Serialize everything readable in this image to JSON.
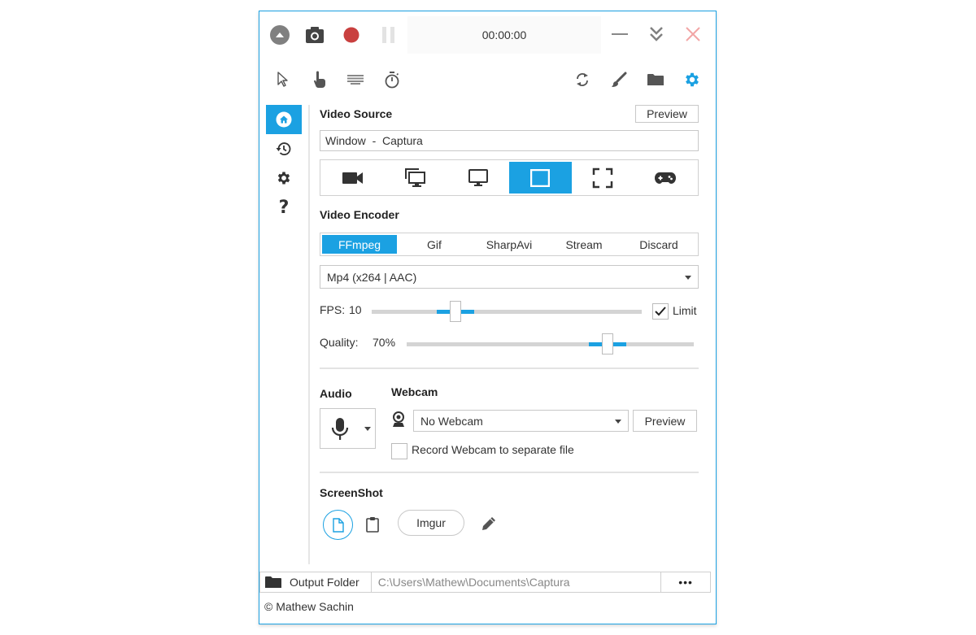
{
  "topbar": {
    "timer": "00:00:00",
    "icons": {
      "collapse": "collapse-up-icon",
      "screenshot": "camera-icon",
      "record": "record-icon",
      "pause": "pause-icon",
      "minimize": "minimize-icon",
      "minimize_tray": "double-chevron-down-icon",
      "close": "close-icon"
    },
    "colors": {
      "record": "#c9403f",
      "close": "#f2a6a6",
      "accent": "#1ba1e2"
    }
  },
  "toolbar": {
    "left": [
      "cursor-icon",
      "click-icon",
      "keystrokes-icon",
      "timer-icon"
    ],
    "right": [
      "refresh-icon",
      "brush-icon",
      "folder-icon",
      "settings-icon"
    ]
  },
  "sidebar": {
    "items": [
      {
        "name": "home",
        "icon": "home-icon",
        "active": true
      },
      {
        "name": "history",
        "icon": "history-icon",
        "active": false
      },
      {
        "name": "settings",
        "icon": "gear-icon",
        "active": false
      },
      {
        "name": "about",
        "icon": "help-icon",
        "active": false
      }
    ]
  },
  "video_source": {
    "title": "Video Source",
    "preview_label": "Preview",
    "current_value": "Window  -  Captura",
    "sources": [
      {
        "name": "webcam",
        "icon": "video-camera-icon",
        "active": false
      },
      {
        "name": "screens",
        "icon": "multi-monitor-icon",
        "active": false
      },
      {
        "name": "screen",
        "icon": "monitor-icon",
        "active": false
      },
      {
        "name": "window",
        "icon": "window-icon",
        "active": true
      },
      {
        "name": "region",
        "icon": "region-icon",
        "active": false
      },
      {
        "name": "game",
        "icon": "gamepad-icon",
        "active": false
      }
    ]
  },
  "video_encoder": {
    "title": "Video Encoder",
    "tabs": [
      {
        "label": "FFmpeg",
        "active": true
      },
      {
        "label": "Gif",
        "active": false
      },
      {
        "label": "SharpAvi",
        "active": false
      },
      {
        "label": "Stream",
        "active": false
      },
      {
        "label": "Discard",
        "active": false
      }
    ],
    "codec": "Mp4 (x264 | AAC)",
    "fps_label": "FPS:",
    "fps_value": "10",
    "fps_slider_fraction": 0.31,
    "limit_label": "Limit",
    "limit_checked": true,
    "quality_label": "Quality:",
    "quality_value": "70%",
    "quality_slider_fraction": 0.7
  },
  "audio": {
    "title": "Audio",
    "icon": "microphone-icon"
  },
  "webcam": {
    "title": "Webcam",
    "selected": "No Webcam",
    "preview_label": "Preview",
    "separate_file_label": "Record Webcam to separate file",
    "separate_file_checked": false
  },
  "screenshot": {
    "title": "ScreenShot",
    "targets": [
      "disk-icon",
      "clipboard-icon"
    ],
    "imgur_label": "Imgur",
    "editor_icon": "pencil-icon"
  },
  "footer": {
    "output_label": "Output Folder",
    "output_path": "C:\\Users\\Mathew\\Documents\\Captura",
    "more_label": "•••",
    "copyright": "© Mathew Sachin"
  }
}
